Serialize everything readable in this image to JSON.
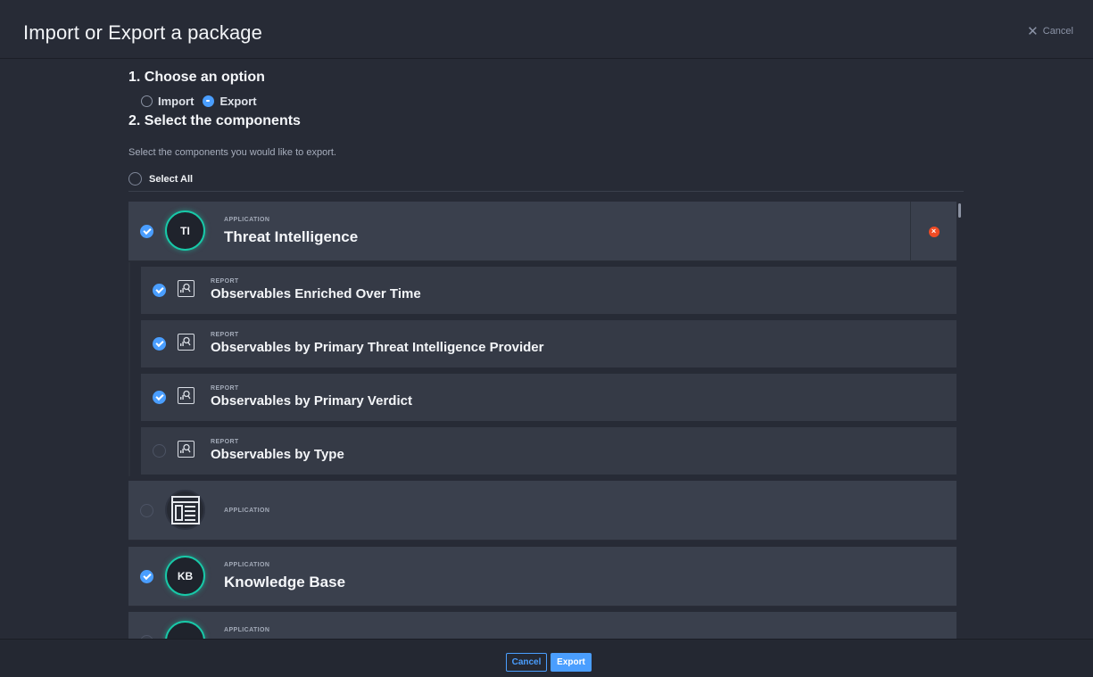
{
  "header": {
    "title": "Import or Export a package",
    "cancel_label": "Cancel"
  },
  "step1": {
    "title": "1. Choose an option",
    "options": [
      {
        "label": "Import",
        "selected": false
      },
      {
        "label": "Export",
        "selected": true
      }
    ]
  },
  "step2": {
    "title": "2. Select the components",
    "description": "Select the components you would like to export.",
    "select_all_label": "Select All"
  },
  "components": [
    {
      "type": "APPLICATION",
      "initials": "TI",
      "name": "Threat Intelligence",
      "checked": true,
      "reports": [
        {
          "type": "REPORT",
          "name": "Observables Enriched Over Time",
          "checked": true
        },
        {
          "type": "REPORT",
          "name": "Observables by Primary Threat Intelligence Provider",
          "checked": true
        },
        {
          "type": "REPORT",
          "name": "Observables by Primary Verdict",
          "checked": true
        },
        {
          "type": "REPORT",
          "name": "Observables by Type",
          "checked": false
        }
      ]
    },
    {
      "type": "APPLICATION",
      "initials": "",
      "name": "",
      "checked": false
    },
    {
      "type": "APPLICATION",
      "initials": "KB",
      "name": "Knowledge Base",
      "checked": true
    },
    {
      "type": "APPLICATION",
      "initials": "",
      "name": "",
      "checked": false
    }
  ],
  "footer": {
    "cancel_label": "Cancel",
    "export_label": "Export"
  },
  "colors": {
    "accent": "#4a9eff",
    "avatar_ring": "#18c9a8",
    "remove": "#f04b24"
  }
}
